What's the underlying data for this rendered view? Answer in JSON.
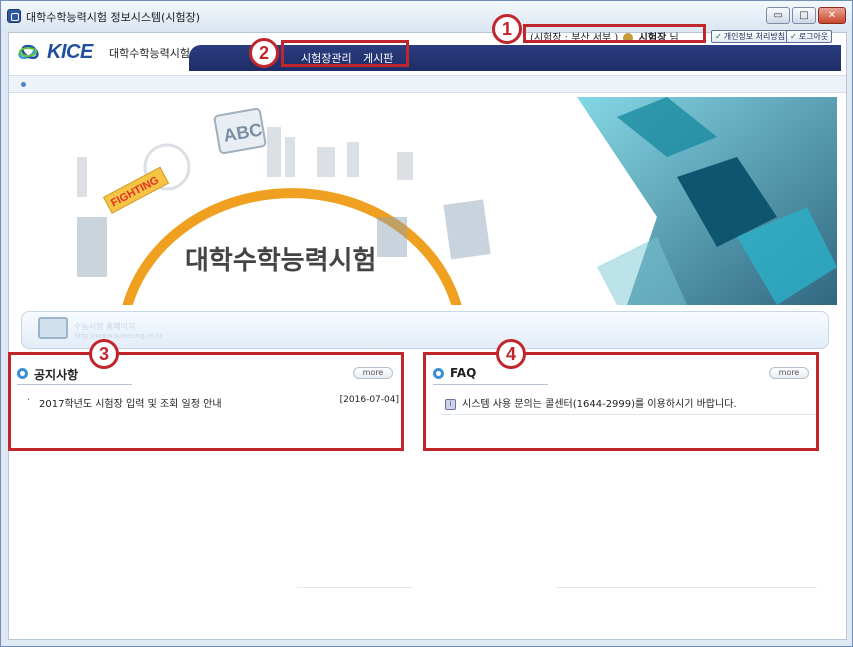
{
  "window": {
    "title": "대학수학능력시험 정보시스템(시험장)",
    "controls": {
      "minimize": "▭",
      "maximize": "□",
      "close": "✕"
    }
  },
  "header": {
    "logo_text": "KICE",
    "system_name": "대학수학능력시험 정보 시스템",
    "user": {
      "prefix": "(시험장 : 부산 서부 )",
      "name": "시험장",
      "suffix": "님"
    },
    "buttons": {
      "privacy": "개인정보 처리방침",
      "logout": "로그아웃"
    }
  },
  "nav": {
    "items": [
      {
        "label": "시험장관리"
      },
      {
        "label": "게시판"
      }
    ]
  },
  "banner": {
    "title": "대학수학능력시험",
    "sign": "FIGHTING",
    "abc": "ABC"
  },
  "exam_bar": {
    "text": "수능시험 홈페이지",
    "url": "http://www.suneung.re.kr"
  },
  "notice": {
    "title": "공지사항",
    "more": "more",
    "items": [
      {
        "text": "2017학년도 시험장 입력 및 조회 일정 안내",
        "date": "[2016-07-04]"
      }
    ]
  },
  "faq": {
    "title": "FAQ",
    "more": "more",
    "items": [
      {
        "text": "시스템 사용 문의는 콜센터(1644-2999)를 이용하시기 바랍니다."
      }
    ]
  },
  "annotations": {
    "markers": [
      "1",
      "2",
      "3",
      "4"
    ],
    "color": "#c0262c"
  },
  "colors": {
    "navbar": "#2b3d80",
    "accent": "#3a8fd6",
    "orange_arc": "#f0a020",
    "teal": "#1f9ab0"
  },
  "icons": [
    "app-icon",
    "user-icon",
    "check-icon",
    "info-icon",
    "monitor-icon"
  ]
}
